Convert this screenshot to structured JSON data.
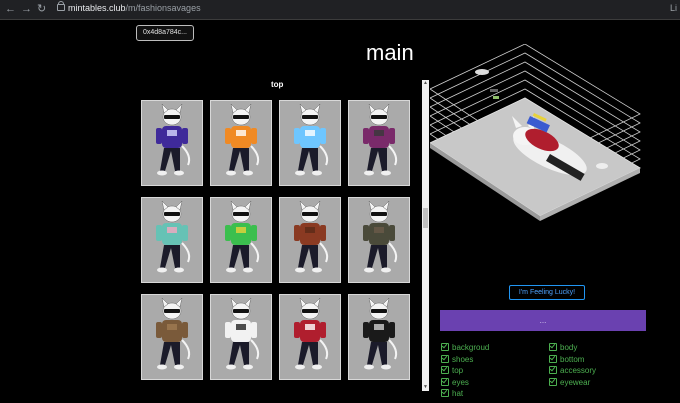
{
  "browser": {
    "url_host": "mintables.club",
    "url_path": "/m/fashionsavages",
    "ext_label": "Li"
  },
  "wallet": {
    "address": "0x4d8a784c..."
  },
  "page": {
    "title": "main"
  },
  "panel": {
    "title": "top"
  },
  "cards": [
    {
      "shirt": "#3f2a9a",
      "accent": "#d8d8ff"
    },
    {
      "shirt": "#f08a24",
      "accent": "#ffffff"
    },
    {
      "shirt": "#6ec6ff",
      "accent": "#ffffff"
    },
    {
      "shirt": "#7a2a6a",
      "accent": "#3a3a3a"
    },
    {
      "shirt": "#66c2b5",
      "accent": "#f4a7c0"
    },
    {
      "shirt": "#3bbf4e",
      "accent": "#e8d23a"
    },
    {
      "shirt": "#8a3a22",
      "accent": "#5a2a18"
    },
    {
      "shirt": "#4a4a3a",
      "accent": "#6a5a4a"
    },
    {
      "shirt": "#7a5a3a",
      "accent": "#a07a52"
    },
    {
      "shirt": "#f2f2f2",
      "accent": "#222222"
    },
    {
      "shirt": "#b01e2e",
      "accent": "#ffffff"
    },
    {
      "shirt": "#1a1a1a",
      "accent": "#d0d0d0"
    }
  ],
  "buttons": {
    "lucky": "I'm Feeling Lucky!",
    "submit": "..."
  },
  "checkboxes": [
    {
      "label": "backgroud",
      "checked": true
    },
    {
      "label": "body",
      "checked": true
    },
    {
      "label": "shoes",
      "checked": true
    },
    {
      "label": "bottom",
      "checked": true
    },
    {
      "label": "top",
      "checked": true
    },
    {
      "label": "accessory",
      "checked": true
    },
    {
      "label": "eyes",
      "checked": true
    },
    {
      "label": "eyewear",
      "checked": true
    },
    {
      "label": "hat",
      "checked": true
    }
  ],
  "colors": {
    "accent_purple": "#6a41b0",
    "check_green": "#4caf50",
    "lucky_blue": "#2196f3"
  }
}
